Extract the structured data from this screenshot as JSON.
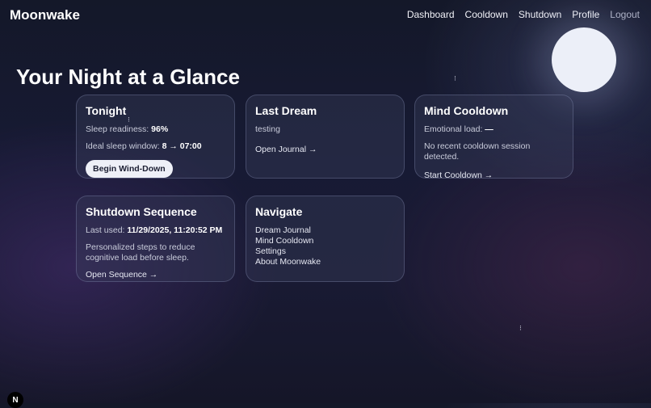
{
  "header": {
    "brand": "Moonwake",
    "nav": [
      "Dashboard",
      "Cooldown",
      "Shutdown",
      "Profile",
      "Logout"
    ]
  },
  "page": {
    "title": "Your Night at a Glance"
  },
  "cards": {
    "tonight": {
      "title": "Tonight",
      "readiness_label": "Sleep readiness: ",
      "readiness_value": "96%",
      "window_label": "Ideal sleep window: ",
      "window_value": "8 → 07:00",
      "button": "Begin Wind-Down"
    },
    "last_dream": {
      "title": "Last Dream",
      "text": "testing",
      "link": "Open Journal →"
    },
    "mind_cooldown": {
      "title": "Mind Cooldown",
      "load_label": "Emotional load: ",
      "load_value": "—",
      "text": "No recent cooldown session detected.",
      "link": "Start Cooldown →"
    },
    "shutdown": {
      "title": "Shutdown Sequence",
      "last_used_label": "Last used: ",
      "last_used_value": "11/29/2025, 11:20:52 PM",
      "text": "Personalized steps to reduce cognitive load before sleep.",
      "link": "Open Sequence →"
    },
    "navigate": {
      "title": "Navigate",
      "items": [
        "Dream Journal",
        "Mind Cooldown",
        "Settings",
        "About Moonwake"
      ]
    }
  },
  "misc": {
    "fab_label": "N"
  }
}
